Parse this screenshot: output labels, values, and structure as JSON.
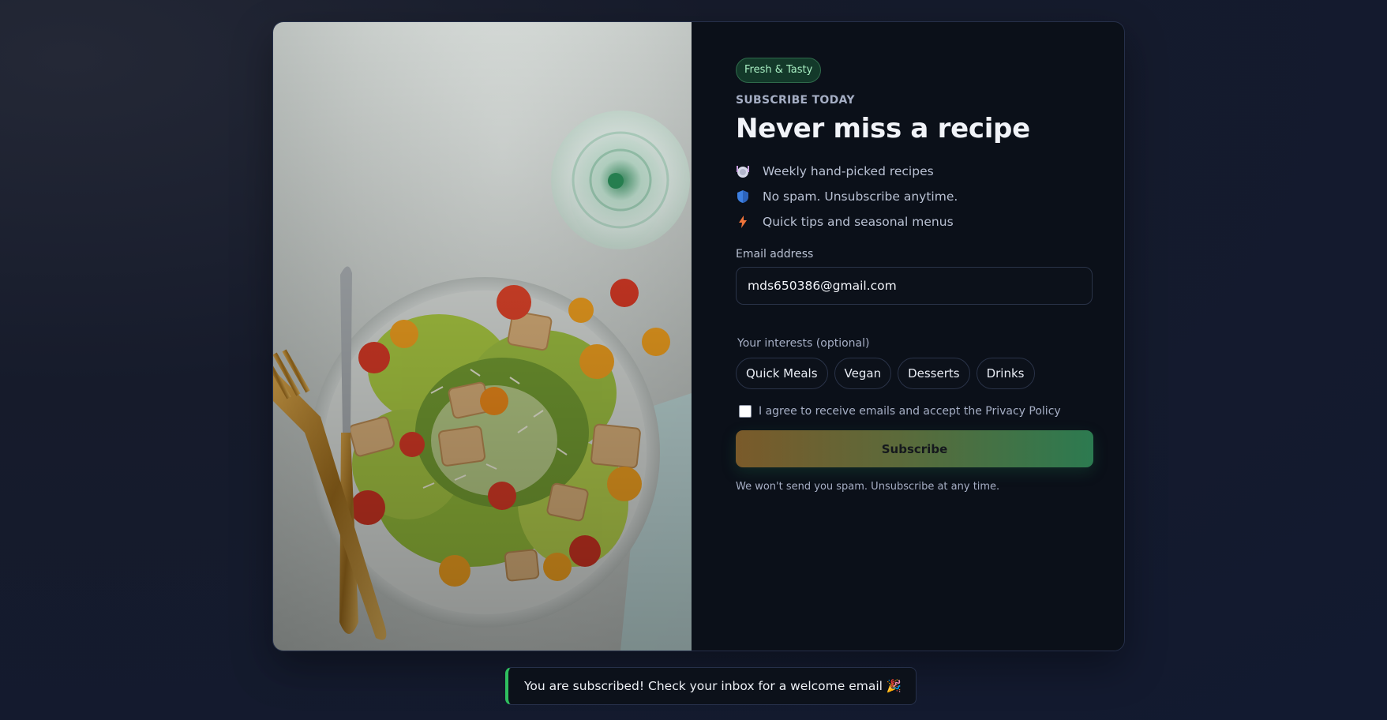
{
  "hero": {
    "image_description_icon": "salad-plate-image"
  },
  "panel": {
    "badge": "Fresh & Tasty",
    "eyebrow": "SUBSCRIBE TODAY",
    "title": "Never miss a recipe",
    "features": [
      {
        "icon": "plate-icon",
        "text": "Weekly hand-picked recipes"
      },
      {
        "icon": "shield-icon",
        "text": "No spam. Unsubscribe anytime."
      },
      {
        "icon": "lightning-icon",
        "text": "Quick tips and seasonal menus"
      }
    ],
    "email_label": "Email address",
    "email_value": "mds650386@gmail.com",
    "interests_label": "Your interests (optional)",
    "interests": [
      "Quick Meals",
      "Vegan",
      "Desserts",
      "Drinks"
    ],
    "agree_text": "I agree to receive emails and accept the Privacy Policy",
    "agree_checked": false,
    "subscribe_label": "Subscribe",
    "note": "We won't send you spam. Unsubscribe at any time."
  },
  "toast": {
    "message": "You are subscribed! Check your inbox for a welcome email 🎉"
  },
  "colors": {
    "accent_green": "#2fbf5f",
    "badge_bg": "#13392a",
    "button_start": "#7a5a2a",
    "button_end": "#2c7a50"
  }
}
